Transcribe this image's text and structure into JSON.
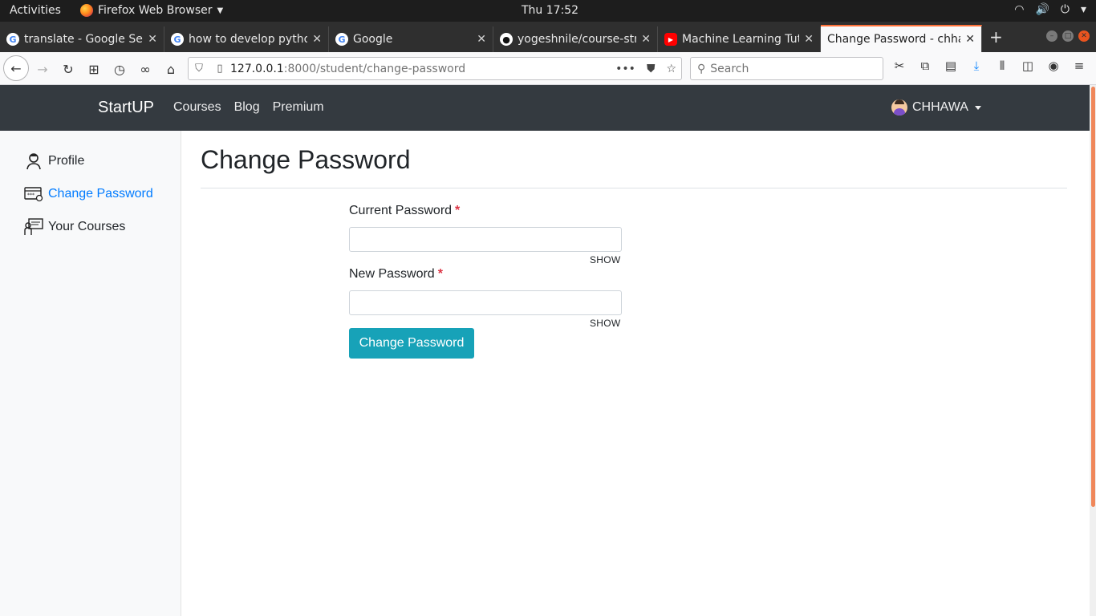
{
  "system": {
    "activities": "Activities",
    "app_name": "Firefox Web Browser",
    "clock": "Thu 17:52"
  },
  "browser": {
    "tabs": [
      {
        "title": "translate - Google Sea",
        "favicon": "google-icon"
      },
      {
        "title": "how to develop pytho",
        "favicon": "google-icon"
      },
      {
        "title": "Google",
        "favicon": "google-icon"
      },
      {
        "title": "yogeshnile/course-str",
        "favicon": "github-icon"
      },
      {
        "title": "Machine Learning Tut",
        "favicon": "youtube-icon"
      },
      {
        "title": "Change Password - chhav",
        "favicon": "none",
        "active": true
      }
    ],
    "url": {
      "host": "127.0.0.1",
      "path": ":8000/student/change-password"
    },
    "search_placeholder": "Search",
    "accent_color": "#ff7139"
  },
  "site": {
    "brand": "StartUP",
    "nav": [
      "Courses",
      "Blog",
      "Premium"
    ],
    "user": "CHHAWA",
    "header_color": "#343a40"
  },
  "sidebar": {
    "items": [
      {
        "label": "Profile",
        "icon": "user-icon"
      },
      {
        "label": "Change Password",
        "icon": "password-icon",
        "active": true
      },
      {
        "label": "Your Courses",
        "icon": "courses-icon"
      }
    ],
    "active_color": "#007bff"
  },
  "main": {
    "title": "Change Password",
    "fields": [
      {
        "label": "Current Password",
        "required": "*",
        "toggle": "SHOW",
        "value": ""
      },
      {
        "label": "New Password",
        "required": "*",
        "toggle": "SHOW",
        "value": ""
      }
    ],
    "submit_label": "Change Password",
    "button_color": "#17a2b8"
  }
}
